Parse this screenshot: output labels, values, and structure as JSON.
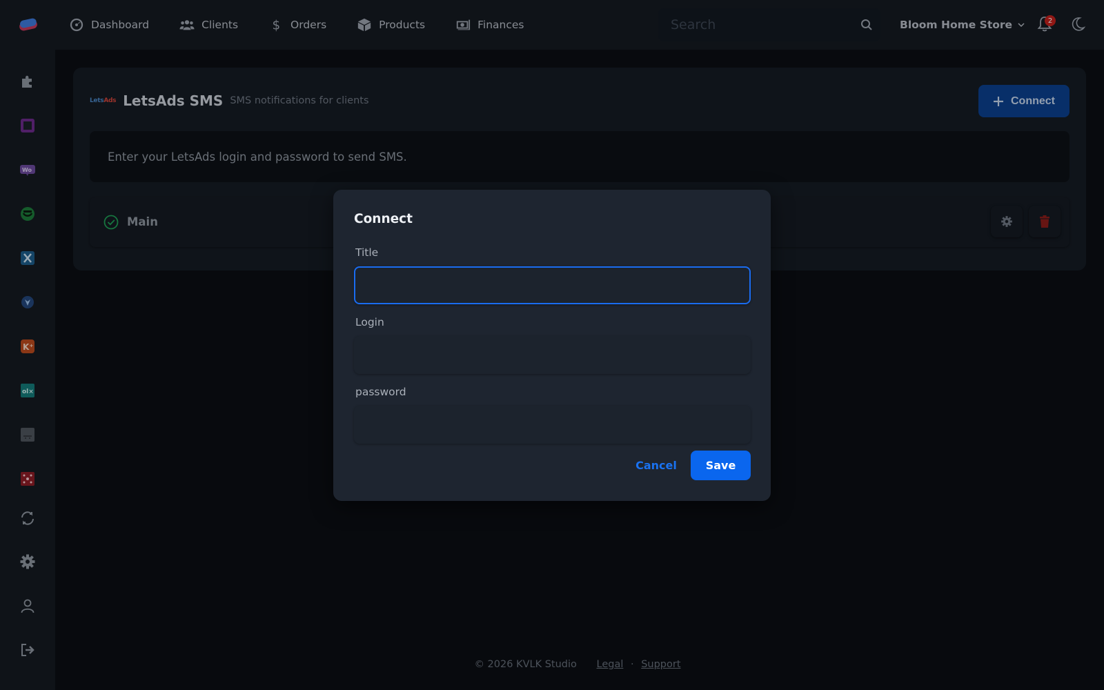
{
  "nav": {
    "items": [
      {
        "label": "Dashboard",
        "icon": "dashboard-icon"
      },
      {
        "label": "Clients",
        "icon": "users-icon"
      },
      {
        "label": "Orders",
        "icon": "dollar-icon"
      },
      {
        "label": "Products",
        "icon": "box-icon"
      },
      {
        "label": "Finances",
        "icon": "money-icon"
      }
    ],
    "search_placeholder": "Search",
    "store_name": "Bloom Home Store",
    "notification_count": "2"
  },
  "integration": {
    "logo_text_a": "Lets",
    "logo_text_b": "Ads",
    "title": "LetsAds SMS",
    "subtitle": "SMS notifications for clients",
    "connect_label": "Connect",
    "info": "Enter your LetsAds login and password to send SMS.",
    "connection_name": "Main"
  },
  "modal": {
    "title": "Connect",
    "title_label": "Title",
    "title_value": "",
    "login_label": "Login",
    "login_value": "",
    "password_label": "password",
    "password_value": "",
    "cancel_label": "Cancel",
    "save_label": "Save"
  },
  "footer": {
    "copyright": "© 2026 KVLK Studio",
    "legal": "Legal",
    "separator": "·",
    "support": "Support"
  },
  "colors": {
    "accent": "#0a66ee",
    "success": "#1f9d55",
    "danger": "#c0211c"
  }
}
